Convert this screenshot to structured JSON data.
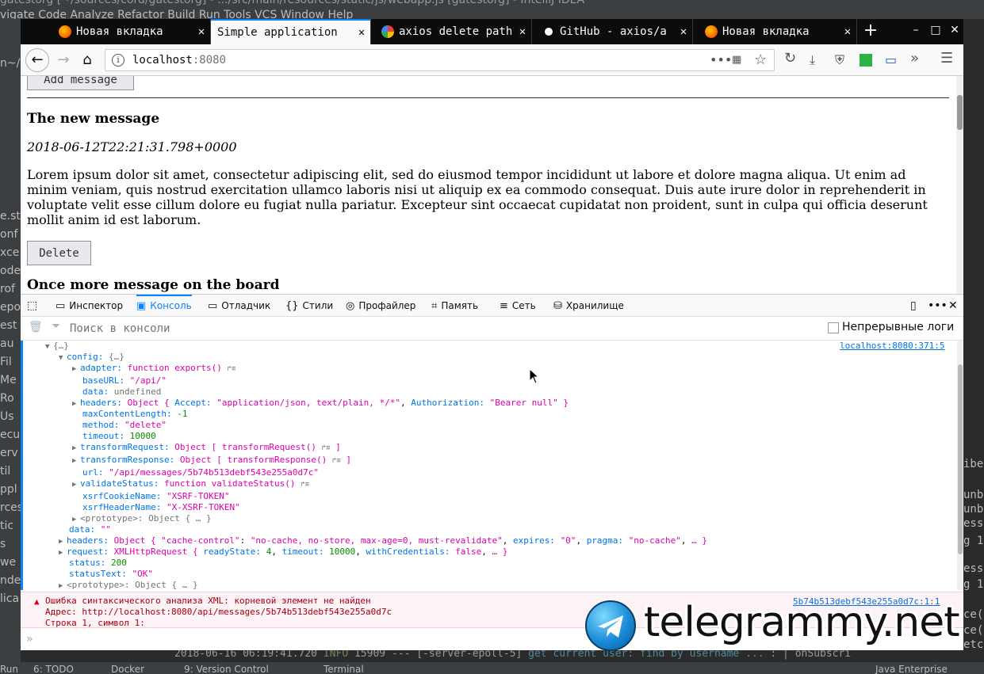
{
  "ide": {
    "title_fragment": "gatestorg [~/sources/cord/gatestorg] - .../src/main/resources/static/js/webapp.js [gatestorg] - IntelliJ IDEA",
    "menu": "vigate  Code  Analyze  Refactor  Build  Run  Tools  VCS  Window  Help",
    "left_panel": [
      "n~/S",
      "e.st",
      "onf",
      "xce",
      "ode",
      "rof",
      "epo",
      "est",
      "au",
      "Fil",
      "Me",
      "Ro",
      "Us",
      "ecu",
      "erv",
      "til",
      "ppl",
      "rces",
      "tic",
      "s",
      "we",
      "ndex",
      "lica"
    ],
    "right_panel": [
      "ibe",
      "unbo",
      "unbo",
      "essa",
      "g 1",
      "essa",
      "g 1",
      "ce()",
      "ce()",
      "etc",
      "ribe"
    ],
    "log_line": {
      "timestamp": "2018-06-16 06:19:41.720",
      "level": "INFO",
      "pid": "15909",
      "thread": "--- [-server-epoll-5]",
      "message": "get current user: find by username ...",
      "tail": ": | onSubscri"
    },
    "statusbar": [
      "Run",
      "6: TODO",
      "Docker",
      "9: Version Control",
      "Terminal",
      "Java Enterprise"
    ]
  },
  "browser": {
    "tabs": [
      {
        "label": "Новая вкладка",
        "icon": "firefox-icon",
        "active": false
      },
      {
        "label": "Simple application",
        "icon": "",
        "active": true
      },
      {
        "label": "axios delete path",
        "icon": "google-icon",
        "active": false
      },
      {
        "label": "GitHub - axios/a",
        "icon": "github-icon",
        "active": false
      },
      {
        "label": "Новая вкладка",
        "icon": "firefox-icon",
        "active": false
      }
    ],
    "new_tab": "+",
    "url_host": "localhost",
    "url_port": ":8080"
  },
  "page": {
    "add_button": "Add message",
    "message1": {
      "title": "The new message",
      "date": "2018-06-12T22:21:31.798+0000",
      "body": "Lorem ipsum dolor sit amet, consectetur adipiscing elit, sed do eiusmod tempor incididunt ut labore et dolore magna aliqua. Ut enim ad minim veniam, quis nostrud exercitation ullamco laboris nisi ut aliquip ex ea commodo consequat. Duis aute irure dolor in reprehenderit in voluptate velit esse cillum dolore eu fugiat nulla pariatur. Excepteur sint occaecat cupidatat non proident, sunt in culpa qui officia deserunt mollit anim id est laborum."
    },
    "delete_button": "Delete",
    "message2": {
      "title": "Once more message on the board"
    }
  },
  "devtools": {
    "tabs": [
      {
        "label": "Инспектор",
        "icon": "inspector-icon",
        "active": false
      },
      {
        "label": "Консоль",
        "icon": "console-icon",
        "active": true
      },
      {
        "label": "Отладчик",
        "icon": "debugger-icon",
        "active": false
      },
      {
        "label": "Стили",
        "icon": "style-editor-icon",
        "active": false
      },
      {
        "label": "Профайлер",
        "icon": "profiler-icon",
        "active": false
      },
      {
        "label": "Память",
        "icon": "memory-icon",
        "active": false
      },
      {
        "label": "Сеть",
        "icon": "network-icon",
        "active": false
      },
      {
        "label": "Хранилище",
        "icon": "storage-icon",
        "active": false
      }
    ],
    "search_placeholder": "Поиск в консоли",
    "persist_logs_label": "Непрерывные логи",
    "console_source": "localhost:8080:371:5",
    "error": {
      "title": "Ошибка синтаксического анализа XML: корневой элемент не найден",
      "address": "Адрес: http://localhost:8080/api/messages/5b74b513debf543e255a0d7c",
      "line": "Строка 1, символ 1:",
      "source": "5b74b513debf543e255a0d7c:1:1"
    }
  },
  "watermark": {
    "text": "telegrammy.net"
  }
}
